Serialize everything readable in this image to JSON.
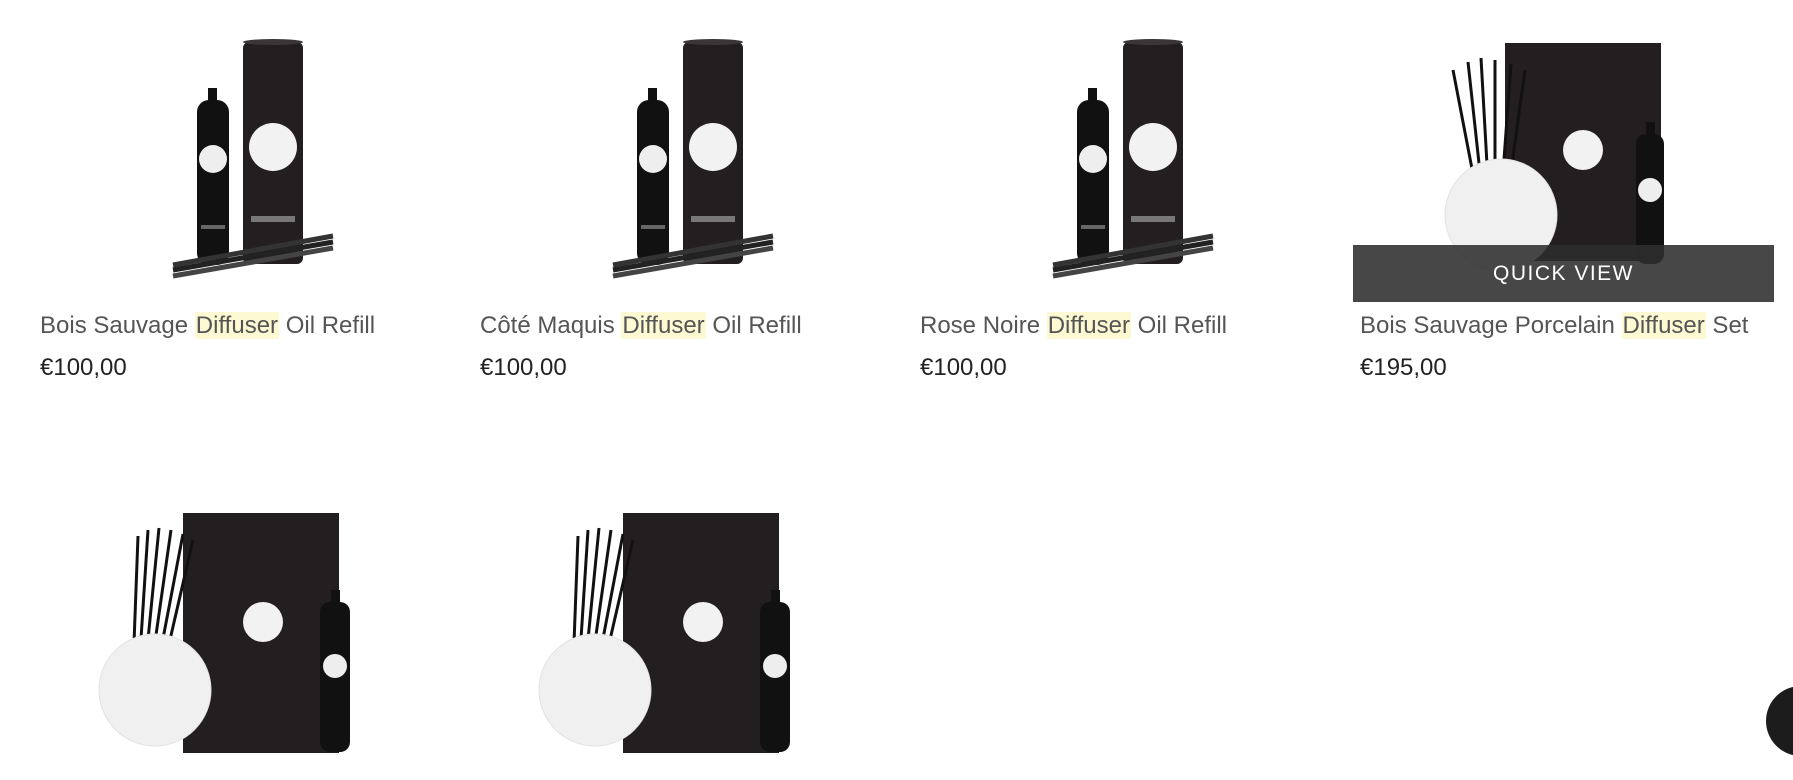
{
  "products": [
    {
      "name_pre": "Bois Sauvage ",
      "name_hl": "Diffuser",
      "name_post": " Oil Refill",
      "price": "€100,00"
    },
    {
      "name_pre": "Côté Maquis ",
      "name_hl": "Diffuser",
      "name_post": " Oil Refill",
      "price": "€100,00"
    },
    {
      "name_pre": "Rose Noire ",
      "name_hl": "Diffuser",
      "name_post": " Oil Refill",
      "price": "€100,00"
    },
    {
      "name_pre": "Bois Sauvage Porcelain ",
      "name_hl": "Diffuser",
      "name_post": " Set",
      "price": "€195,00",
      "quick_view": "QUICK VIEW"
    },
    {
      "name_pre": "",
      "name_hl": "",
      "name_post": "",
      "price": ""
    },
    {
      "name_pre": "",
      "name_hl": "",
      "name_post": "",
      "price": ""
    }
  ],
  "colors": {
    "highlight": "#fdf9d2",
    "overlay": "#2d2d2d",
    "product_dark": "#1a1718"
  },
  "chat_icon": "chat-icon"
}
